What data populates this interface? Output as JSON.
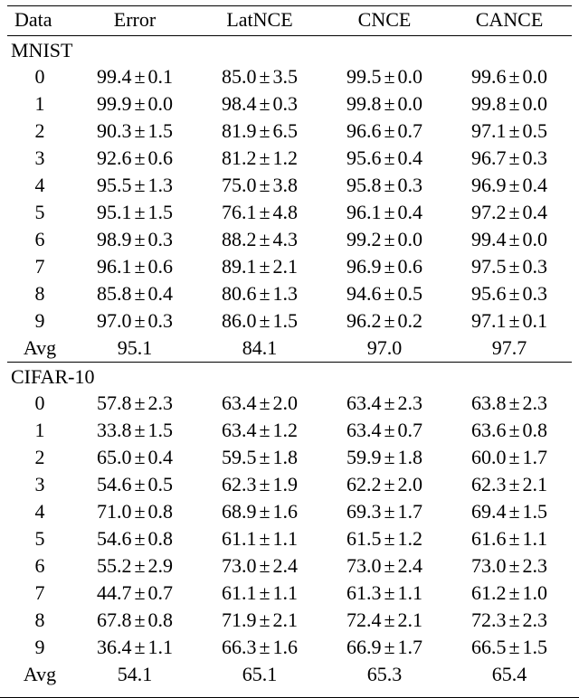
{
  "chart_data": {
    "type": "table",
    "title": "",
    "columns": [
      "Data",
      "Error",
      "LatNCE",
      "CNCE",
      "CANCE"
    ],
    "sections": [
      {
        "name": "MNIST",
        "rows": [
          {
            "data": "0",
            "Error": {
              "v": 99.4,
              "e": 0.1
            },
            "LatNCE": {
              "v": 85.0,
              "e": 3.5
            },
            "CNCE": {
              "v": 99.5,
              "e": 0.0
            },
            "CANCE": {
              "v": 99.6,
              "e": 0.0
            }
          },
          {
            "data": "1",
            "Error": {
              "v": 99.9,
              "e": 0.0
            },
            "LatNCE": {
              "v": 98.4,
              "e": 0.3
            },
            "CNCE": {
              "v": 99.8,
              "e": 0.0
            },
            "CANCE": {
              "v": 99.8,
              "e": 0.0
            }
          },
          {
            "data": "2",
            "Error": {
              "v": 90.3,
              "e": 1.5
            },
            "LatNCE": {
              "v": 81.9,
              "e": 6.5
            },
            "CNCE": {
              "v": 96.6,
              "e": 0.7
            },
            "CANCE": {
              "v": 97.1,
              "e": 0.5
            }
          },
          {
            "data": "3",
            "Error": {
              "v": 92.6,
              "e": 0.6
            },
            "LatNCE": {
              "v": 81.2,
              "e": 1.2
            },
            "CNCE": {
              "v": 95.6,
              "e": 0.4
            },
            "CANCE": {
              "v": 96.7,
              "e": 0.3
            }
          },
          {
            "data": "4",
            "Error": {
              "v": 95.5,
              "e": 1.3
            },
            "LatNCE": {
              "v": 75.0,
              "e": 3.8
            },
            "CNCE": {
              "v": 95.8,
              "e": 0.3
            },
            "CANCE": {
              "v": 96.9,
              "e": 0.4
            }
          },
          {
            "data": "5",
            "Error": {
              "v": 95.1,
              "e": 1.5
            },
            "LatNCE": {
              "v": 76.1,
              "e": 4.8
            },
            "CNCE": {
              "v": 96.1,
              "e": 0.4
            },
            "CANCE": {
              "v": 97.2,
              "e": 0.4
            }
          },
          {
            "data": "6",
            "Error": {
              "v": 98.9,
              "e": 0.3
            },
            "LatNCE": {
              "v": 88.2,
              "e": 4.3
            },
            "CNCE": {
              "v": 99.2,
              "e": 0.0
            },
            "CANCE": {
              "v": 99.4,
              "e": 0.0
            }
          },
          {
            "data": "7",
            "Error": {
              "v": 96.1,
              "e": 0.6
            },
            "LatNCE": {
              "v": 89.1,
              "e": 2.1
            },
            "CNCE": {
              "v": 96.9,
              "e": 0.6
            },
            "CANCE": {
              "v": 97.5,
              "e": 0.3
            }
          },
          {
            "data": "8",
            "Error": {
              "v": 85.8,
              "e": 0.4
            },
            "LatNCE": {
              "v": 80.6,
              "e": 1.3
            },
            "CNCE": {
              "v": 94.6,
              "e": 0.5
            },
            "CANCE": {
              "v": 95.6,
              "e": 0.3
            }
          },
          {
            "data": "9",
            "Error": {
              "v": 97.0,
              "e": 0.3
            },
            "LatNCE": {
              "v": 86.0,
              "e": 1.5
            },
            "CNCE": {
              "v": 96.2,
              "e": 0.2
            },
            "CANCE": {
              "v": 97.1,
              "e": 0.1
            }
          }
        ],
        "avg": {
          "label": "Avg",
          "Error": 95.1,
          "LatNCE": 84.1,
          "CNCE": 97.0,
          "CANCE": 97.7
        }
      },
      {
        "name": "CIFAR-10",
        "rows": [
          {
            "data": "0",
            "Error": {
              "v": 57.8,
              "e": 2.3
            },
            "LatNCE": {
              "v": 63.4,
              "e": 2.0
            },
            "CNCE": {
              "v": 63.4,
              "e": 2.3
            },
            "CANCE": {
              "v": 63.8,
              "e": 2.3
            }
          },
          {
            "data": "1",
            "Error": {
              "v": 33.8,
              "e": 1.5
            },
            "LatNCE": {
              "v": 63.4,
              "e": 1.2
            },
            "CNCE": {
              "v": 63.4,
              "e": 0.7
            },
            "CANCE": {
              "v": 63.6,
              "e": 0.8
            }
          },
          {
            "data": "2",
            "Error": {
              "v": 65.0,
              "e": 0.4
            },
            "LatNCE": {
              "v": 59.5,
              "e": 1.8
            },
            "CNCE": {
              "v": 59.9,
              "e": 1.8
            },
            "CANCE": {
              "v": 60.0,
              "e": 1.7
            }
          },
          {
            "data": "3",
            "Error": {
              "v": 54.6,
              "e": 0.5
            },
            "LatNCE": {
              "v": 62.3,
              "e": 1.9
            },
            "CNCE": {
              "v": 62.2,
              "e": 2.0
            },
            "CANCE": {
              "v": 62.3,
              "e": 2.1
            }
          },
          {
            "data": "4",
            "Error": {
              "v": 71.0,
              "e": 0.8
            },
            "LatNCE": {
              "v": 68.9,
              "e": 1.6
            },
            "CNCE": {
              "v": 69.3,
              "e": 1.7
            },
            "CANCE": {
              "v": 69.4,
              "e": 1.5
            }
          },
          {
            "data": "5",
            "Error": {
              "v": 54.6,
              "e": 0.8
            },
            "LatNCE": {
              "v": 61.1,
              "e": 1.1
            },
            "CNCE": {
              "v": 61.5,
              "e": 1.2
            },
            "CANCE": {
              "v": 61.6,
              "e": 1.1
            }
          },
          {
            "data": "6",
            "Error": {
              "v": 55.2,
              "e": 2.9
            },
            "LatNCE": {
              "v": 73.0,
              "e": 2.4
            },
            "CNCE": {
              "v": 73.0,
              "e": 2.4
            },
            "CANCE": {
              "v": 73.0,
              "e": 2.3
            }
          },
          {
            "data": "7",
            "Error": {
              "v": 44.7,
              "e": 0.7
            },
            "LatNCE": {
              "v": 61.1,
              "e": 1.1
            },
            "CNCE": {
              "v": 61.3,
              "e": 1.1
            },
            "CANCE": {
              "v": 61.2,
              "e": 1.0
            }
          },
          {
            "data": "8",
            "Error": {
              "v": 67.8,
              "e": 0.8
            },
            "LatNCE": {
              "v": 71.9,
              "e": 2.1
            },
            "CNCE": {
              "v": 72.4,
              "e": 2.1
            },
            "CANCE": {
              "v": 72.3,
              "e": 2.3
            }
          },
          {
            "data": "9",
            "Error": {
              "v": 36.4,
              "e": 1.1
            },
            "LatNCE": {
              "v": 66.3,
              "e": 1.6
            },
            "CNCE": {
              "v": 66.9,
              "e": 1.7
            },
            "CANCE": {
              "v": 66.5,
              "e": 1.5
            }
          }
        ],
        "avg": {
          "label": "Avg",
          "Error": 54.1,
          "LatNCE": 65.1,
          "CNCE": 65.3,
          "CANCE": 65.4
        }
      }
    ]
  },
  "symbols": {
    "pm": "±"
  }
}
